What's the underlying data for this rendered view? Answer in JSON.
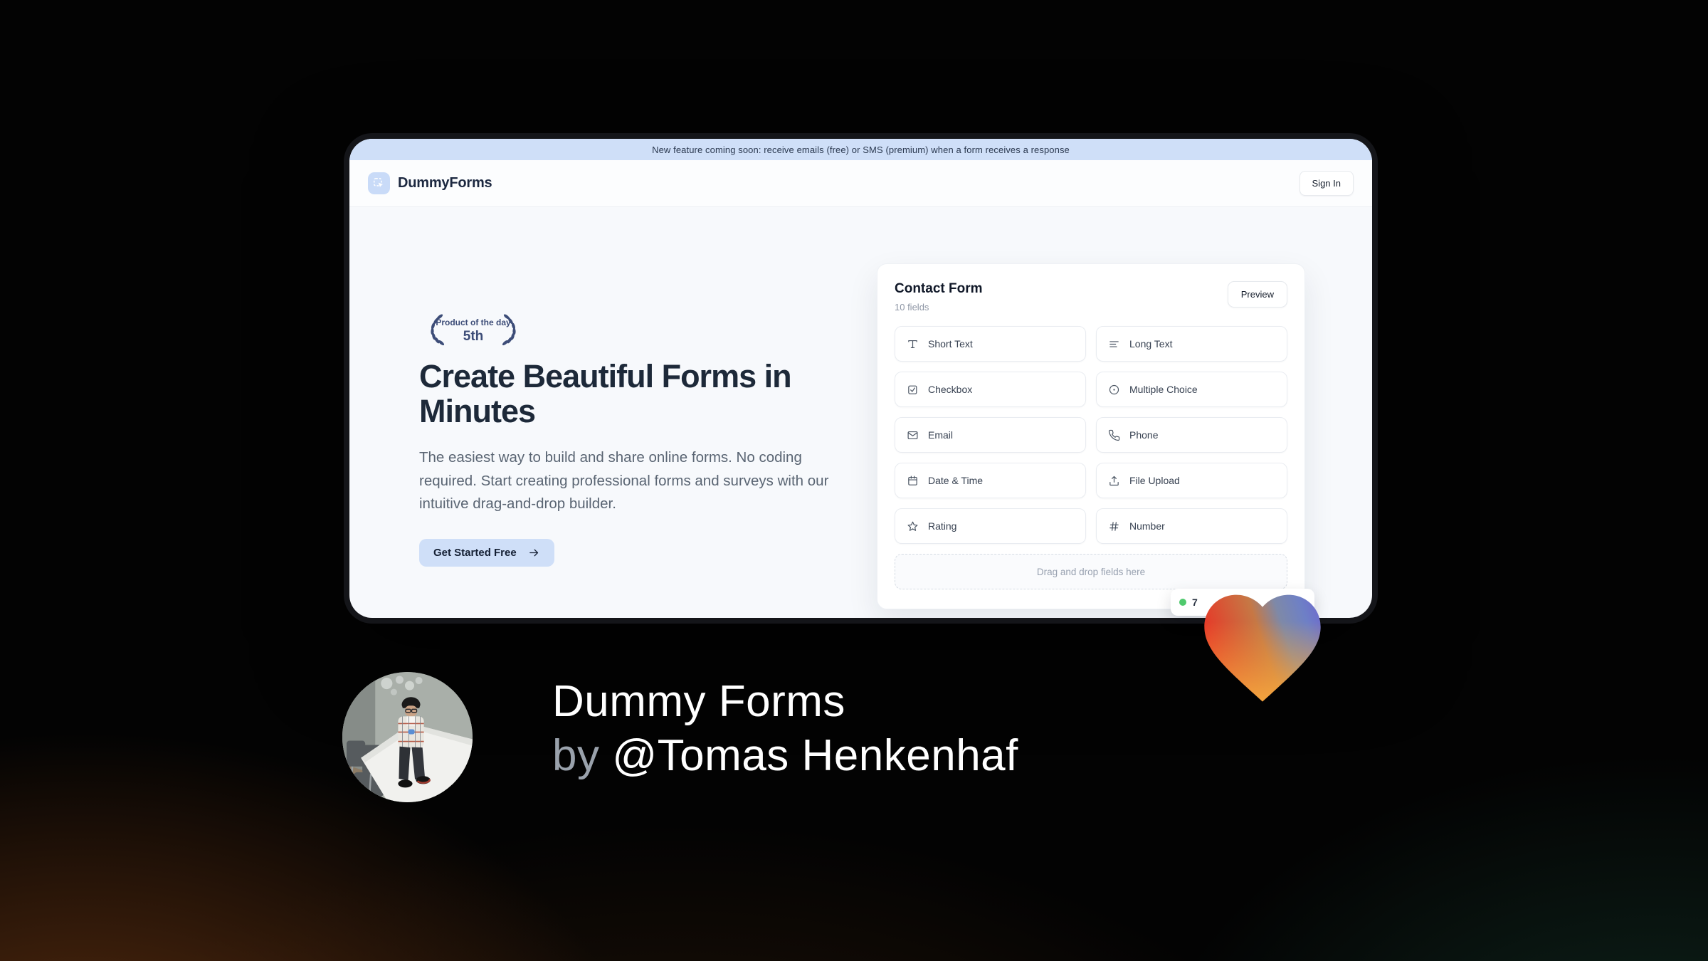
{
  "banner": {
    "text": "New feature coming soon: receive emails (free) or SMS (premium) when a form receives a response"
  },
  "header": {
    "brand": "DummyForms",
    "sign_in": "Sign In"
  },
  "hero": {
    "badge": {
      "title": "Product of the day",
      "rank": "5th"
    },
    "heading_lines": [
      "Create Beautiful Forms in",
      "Minutes"
    ],
    "description": "The easiest way to build and share online forms. No coding required. Start creating professional forms and surveys with our intuitive drag-and-drop builder.",
    "cta": "Get Started Free"
  },
  "form_builder": {
    "title": "Contact Form",
    "field_count": "10 fields",
    "preview": "Preview",
    "fields": [
      {
        "label": "Short Text",
        "icon": "type-icon"
      },
      {
        "label": "Long Text",
        "icon": "align-left-icon"
      },
      {
        "label": "Checkbox",
        "icon": "checkbox-icon"
      },
      {
        "label": "Multiple Choice",
        "icon": "radio-icon"
      },
      {
        "label": "Email",
        "icon": "mail-icon"
      },
      {
        "label": "Phone",
        "icon": "phone-icon"
      },
      {
        "label": "Date & Time",
        "icon": "calendar-icon"
      },
      {
        "label": "File Upload",
        "icon": "upload-icon"
      },
      {
        "label": "Rating",
        "icon": "star-icon"
      },
      {
        "label": "Number",
        "icon": "hash-icon"
      }
    ],
    "dropzone": "Drag and drop fields here",
    "status_badge": {
      "visible_text": "7"
    }
  },
  "caption": {
    "line1": "Dummy Forms",
    "by": "by",
    "handle": "@Tomas Henkenhaf"
  },
  "colors": {
    "accent_blue": "#cfdff8",
    "brand_navy": "#1d2939",
    "laurel_navy": "#3d4d78",
    "status_green": "#4fc96d",
    "heart_gradient": [
      "#e63928",
      "#f2a23c",
      "#6e86c3",
      "#6f66cf"
    ],
    "bg_glow_warm": "#60300f",
    "bg_glow_teal": "#143428"
  }
}
